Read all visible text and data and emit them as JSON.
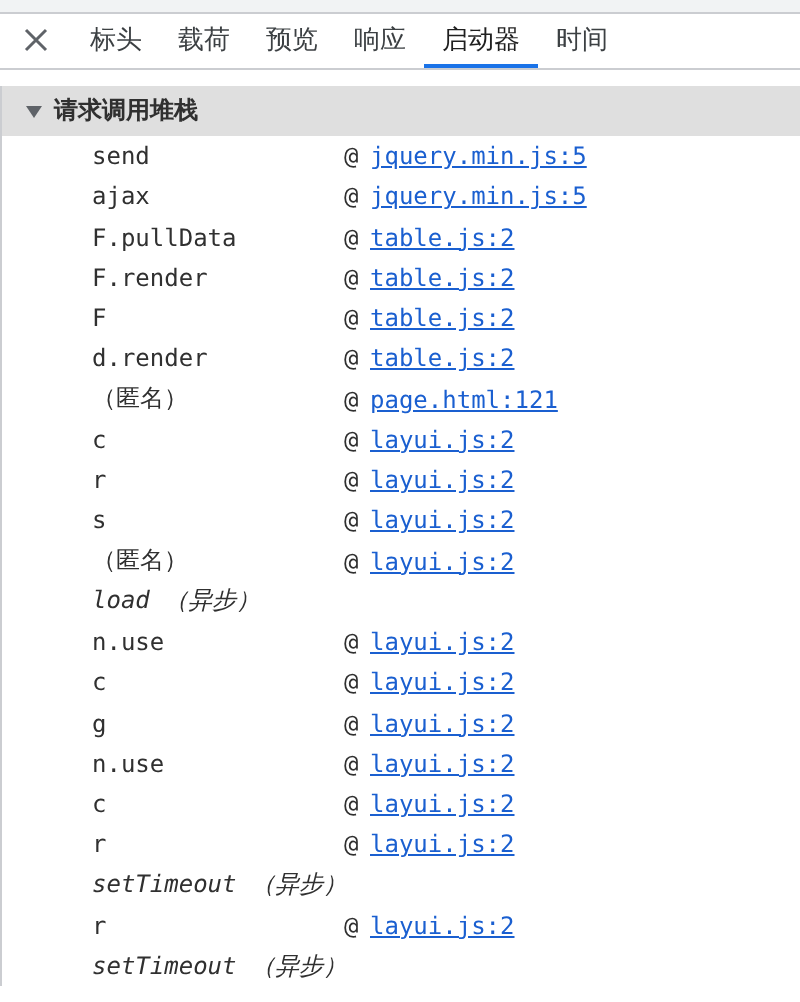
{
  "tabs": [
    {
      "label": "标头",
      "selected": false
    },
    {
      "label": "载荷",
      "selected": false
    },
    {
      "label": "预览",
      "selected": false
    },
    {
      "label": "响应",
      "selected": false
    },
    {
      "label": "启动器",
      "selected": true
    },
    {
      "label": "时间",
      "selected": false
    }
  ],
  "section": {
    "title": "请求调用堆栈",
    "expanded": true
  },
  "frames": [
    {
      "kind": "call",
      "function": "send",
      "at": "@",
      "source": "jquery.min.js:5"
    },
    {
      "kind": "call",
      "function": "ajax",
      "at": "@",
      "source": "jquery.min.js:5"
    },
    {
      "kind": "call",
      "function": "F.pullData",
      "at": "@",
      "source": "table.js:2"
    },
    {
      "kind": "call",
      "function": "F.render",
      "at": "@",
      "source": "table.js:2"
    },
    {
      "kind": "call",
      "function": "F",
      "at": "@",
      "source": "table.js:2"
    },
    {
      "kind": "call",
      "function": "d.render",
      "at": "@",
      "source": "table.js:2"
    },
    {
      "kind": "call",
      "function": "（匿名）",
      "at": "@",
      "source": "page.html:121"
    },
    {
      "kind": "call",
      "function": "c",
      "at": "@",
      "source": "layui.js:2"
    },
    {
      "kind": "call",
      "function": "r",
      "at": "@",
      "source": "layui.js:2"
    },
    {
      "kind": "call",
      "function": "s",
      "at": "@",
      "source": "layui.js:2"
    },
    {
      "kind": "call",
      "function": "（匿名）",
      "at": "@",
      "source": "layui.js:2"
    },
    {
      "kind": "async",
      "function": "load",
      "note": "（异步）"
    },
    {
      "kind": "call",
      "function": "n.use",
      "at": "@",
      "source": "layui.js:2"
    },
    {
      "kind": "call",
      "function": "c",
      "at": "@",
      "source": "layui.js:2"
    },
    {
      "kind": "call",
      "function": "g",
      "at": "@",
      "source": "layui.js:2"
    },
    {
      "kind": "call",
      "function": "n.use",
      "at": "@",
      "source": "layui.js:2"
    },
    {
      "kind": "call",
      "function": "c",
      "at": "@",
      "source": "layui.js:2"
    },
    {
      "kind": "call",
      "function": "r",
      "at": "@",
      "source": "layui.js:2"
    },
    {
      "kind": "async",
      "function": "setTimeout",
      "note": "（异步）"
    },
    {
      "kind": "call",
      "function": "r",
      "at": "@",
      "source": "layui.js:2"
    },
    {
      "kind": "async",
      "function": "setTimeout",
      "note": "（异步）"
    }
  ]
}
